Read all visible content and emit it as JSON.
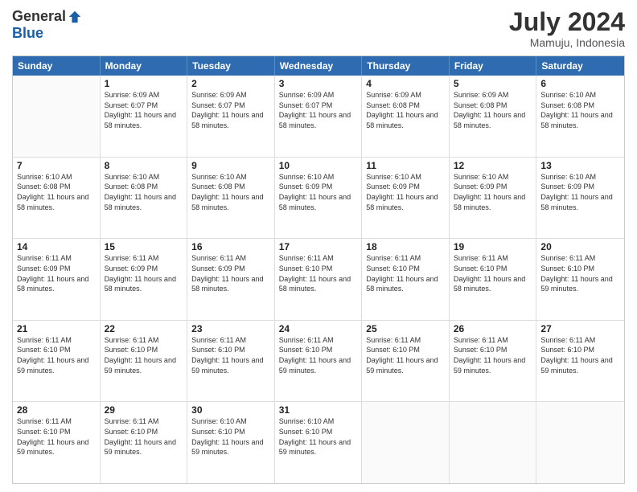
{
  "logo": {
    "general": "General",
    "blue": "Blue"
  },
  "title": "July 2024",
  "location": "Mamuju, Indonesia",
  "days_of_week": [
    "Sunday",
    "Monday",
    "Tuesday",
    "Wednesday",
    "Thursday",
    "Friday",
    "Saturday"
  ],
  "weeks": [
    [
      {
        "day": "",
        "sunrise": "",
        "sunset": "",
        "daylight": ""
      },
      {
        "day": "1",
        "sunrise": "Sunrise: 6:09 AM",
        "sunset": "Sunset: 6:07 PM",
        "daylight": "Daylight: 11 hours and 58 minutes."
      },
      {
        "day": "2",
        "sunrise": "Sunrise: 6:09 AM",
        "sunset": "Sunset: 6:07 PM",
        "daylight": "Daylight: 11 hours and 58 minutes."
      },
      {
        "day": "3",
        "sunrise": "Sunrise: 6:09 AM",
        "sunset": "Sunset: 6:07 PM",
        "daylight": "Daylight: 11 hours and 58 minutes."
      },
      {
        "day": "4",
        "sunrise": "Sunrise: 6:09 AM",
        "sunset": "Sunset: 6:08 PM",
        "daylight": "Daylight: 11 hours and 58 minutes."
      },
      {
        "day": "5",
        "sunrise": "Sunrise: 6:09 AM",
        "sunset": "Sunset: 6:08 PM",
        "daylight": "Daylight: 11 hours and 58 minutes."
      },
      {
        "day": "6",
        "sunrise": "Sunrise: 6:10 AM",
        "sunset": "Sunset: 6:08 PM",
        "daylight": "Daylight: 11 hours and 58 minutes."
      }
    ],
    [
      {
        "day": "7",
        "sunrise": "Sunrise: 6:10 AM",
        "sunset": "Sunset: 6:08 PM",
        "daylight": "Daylight: 11 hours and 58 minutes."
      },
      {
        "day": "8",
        "sunrise": "Sunrise: 6:10 AM",
        "sunset": "Sunset: 6:08 PM",
        "daylight": "Daylight: 11 hours and 58 minutes."
      },
      {
        "day": "9",
        "sunrise": "Sunrise: 6:10 AM",
        "sunset": "Sunset: 6:08 PM",
        "daylight": "Daylight: 11 hours and 58 minutes."
      },
      {
        "day": "10",
        "sunrise": "Sunrise: 6:10 AM",
        "sunset": "Sunset: 6:09 PM",
        "daylight": "Daylight: 11 hours and 58 minutes."
      },
      {
        "day": "11",
        "sunrise": "Sunrise: 6:10 AM",
        "sunset": "Sunset: 6:09 PM",
        "daylight": "Daylight: 11 hours and 58 minutes."
      },
      {
        "day": "12",
        "sunrise": "Sunrise: 6:10 AM",
        "sunset": "Sunset: 6:09 PM",
        "daylight": "Daylight: 11 hours and 58 minutes."
      },
      {
        "day": "13",
        "sunrise": "Sunrise: 6:10 AM",
        "sunset": "Sunset: 6:09 PM",
        "daylight": "Daylight: 11 hours and 58 minutes."
      }
    ],
    [
      {
        "day": "14",
        "sunrise": "Sunrise: 6:11 AM",
        "sunset": "Sunset: 6:09 PM",
        "daylight": "Daylight: 11 hours and 58 minutes."
      },
      {
        "day": "15",
        "sunrise": "Sunrise: 6:11 AM",
        "sunset": "Sunset: 6:09 PM",
        "daylight": "Daylight: 11 hours and 58 minutes."
      },
      {
        "day": "16",
        "sunrise": "Sunrise: 6:11 AM",
        "sunset": "Sunset: 6:09 PM",
        "daylight": "Daylight: 11 hours and 58 minutes."
      },
      {
        "day": "17",
        "sunrise": "Sunrise: 6:11 AM",
        "sunset": "Sunset: 6:10 PM",
        "daylight": "Daylight: 11 hours and 58 minutes."
      },
      {
        "day": "18",
        "sunrise": "Sunrise: 6:11 AM",
        "sunset": "Sunset: 6:10 PM",
        "daylight": "Daylight: 11 hours and 58 minutes."
      },
      {
        "day": "19",
        "sunrise": "Sunrise: 6:11 AM",
        "sunset": "Sunset: 6:10 PM",
        "daylight": "Daylight: 11 hours and 58 minutes."
      },
      {
        "day": "20",
        "sunrise": "Sunrise: 6:11 AM",
        "sunset": "Sunset: 6:10 PM",
        "daylight": "Daylight: 11 hours and 59 minutes."
      }
    ],
    [
      {
        "day": "21",
        "sunrise": "Sunrise: 6:11 AM",
        "sunset": "Sunset: 6:10 PM",
        "daylight": "Daylight: 11 hours and 59 minutes."
      },
      {
        "day": "22",
        "sunrise": "Sunrise: 6:11 AM",
        "sunset": "Sunset: 6:10 PM",
        "daylight": "Daylight: 11 hours and 59 minutes."
      },
      {
        "day": "23",
        "sunrise": "Sunrise: 6:11 AM",
        "sunset": "Sunset: 6:10 PM",
        "daylight": "Daylight: 11 hours and 59 minutes."
      },
      {
        "day": "24",
        "sunrise": "Sunrise: 6:11 AM",
        "sunset": "Sunset: 6:10 PM",
        "daylight": "Daylight: 11 hours and 59 minutes."
      },
      {
        "day": "25",
        "sunrise": "Sunrise: 6:11 AM",
        "sunset": "Sunset: 6:10 PM",
        "daylight": "Daylight: 11 hours and 59 minutes."
      },
      {
        "day": "26",
        "sunrise": "Sunrise: 6:11 AM",
        "sunset": "Sunset: 6:10 PM",
        "daylight": "Daylight: 11 hours and 59 minutes."
      },
      {
        "day": "27",
        "sunrise": "Sunrise: 6:11 AM",
        "sunset": "Sunset: 6:10 PM",
        "daylight": "Daylight: 11 hours and 59 minutes."
      }
    ],
    [
      {
        "day": "28",
        "sunrise": "Sunrise: 6:11 AM",
        "sunset": "Sunset: 6:10 PM",
        "daylight": "Daylight: 11 hours and 59 minutes."
      },
      {
        "day": "29",
        "sunrise": "Sunrise: 6:11 AM",
        "sunset": "Sunset: 6:10 PM",
        "daylight": "Daylight: 11 hours and 59 minutes."
      },
      {
        "day": "30",
        "sunrise": "Sunrise: 6:10 AM",
        "sunset": "Sunset: 6:10 PM",
        "daylight": "Daylight: 11 hours and 59 minutes."
      },
      {
        "day": "31",
        "sunrise": "Sunrise: 6:10 AM",
        "sunset": "Sunset: 6:10 PM",
        "daylight": "Daylight: 11 hours and 59 minutes."
      },
      {
        "day": "",
        "sunrise": "",
        "sunset": "",
        "daylight": ""
      },
      {
        "day": "",
        "sunrise": "",
        "sunset": "",
        "daylight": ""
      },
      {
        "day": "",
        "sunrise": "",
        "sunset": "",
        "daylight": ""
      }
    ]
  ]
}
